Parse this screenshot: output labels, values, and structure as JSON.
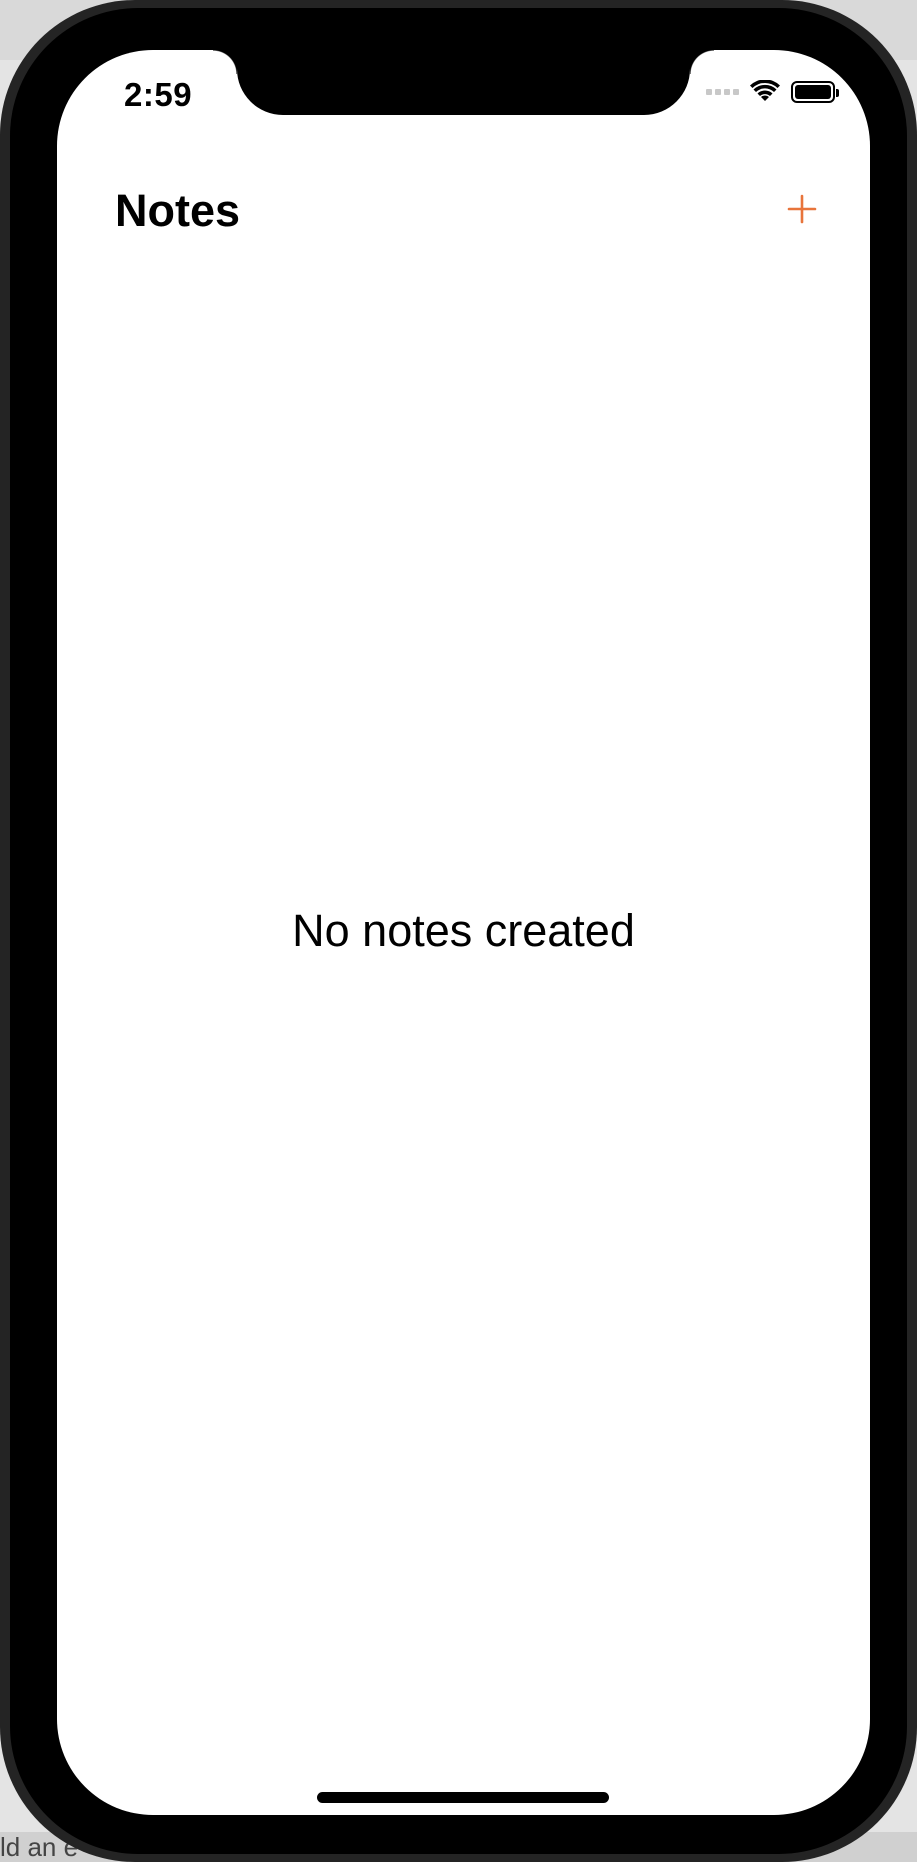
{
  "status_bar": {
    "time": "2:59",
    "wifi_icon": "wifi-icon",
    "battery_icon": "battery-icon",
    "signal_icon": "signal-dots-icon"
  },
  "nav": {
    "title": "Notes",
    "add_icon": "plus-icon",
    "accent_color": "#e8743b"
  },
  "main": {
    "empty_message": "No notes created"
  },
  "background": {
    "bottom_text": "ld an e"
  }
}
